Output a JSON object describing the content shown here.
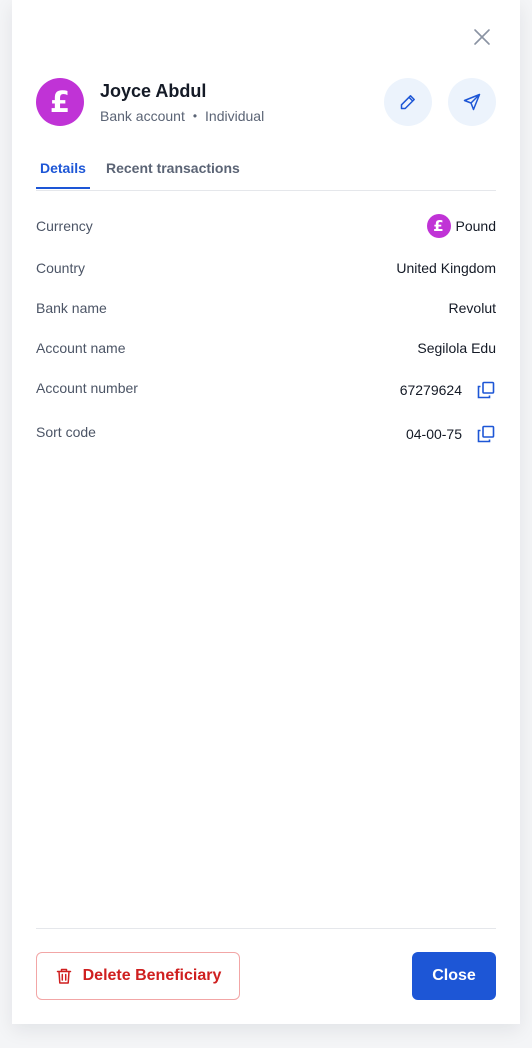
{
  "header": {
    "name": "Joyce Abdul",
    "account_type": "Bank account",
    "separator": "•",
    "entity_type": "Individual",
    "avatar_symbol": "£"
  },
  "tabs": [
    {
      "label": "Details",
      "active": true
    },
    {
      "label": "Recent transactions",
      "active": false
    }
  ],
  "details": {
    "currency": {
      "label": "Currency",
      "value": "Pound",
      "symbol": "£"
    },
    "country": {
      "label": "Country",
      "value": "United Kingdom"
    },
    "bank_name": {
      "label": "Bank name",
      "value": "Revolut"
    },
    "account_name": {
      "label": "Account name",
      "value": "Segilola Edu"
    },
    "account_number": {
      "label": "Account number",
      "value": "67279624"
    },
    "sort_code": {
      "label": "Sort code",
      "value": "04-00-75"
    }
  },
  "footer": {
    "delete_label": "Delete Beneficiary",
    "close_label": "Close"
  },
  "icons": {
    "close": "close-icon",
    "edit": "pencil-icon",
    "send": "send-icon",
    "copy": "copy-icon",
    "delete": "trash-icon"
  },
  "colors": {
    "accent": "#1d56d6",
    "avatar": "#c033d6",
    "danger": "#cf1f1f"
  }
}
